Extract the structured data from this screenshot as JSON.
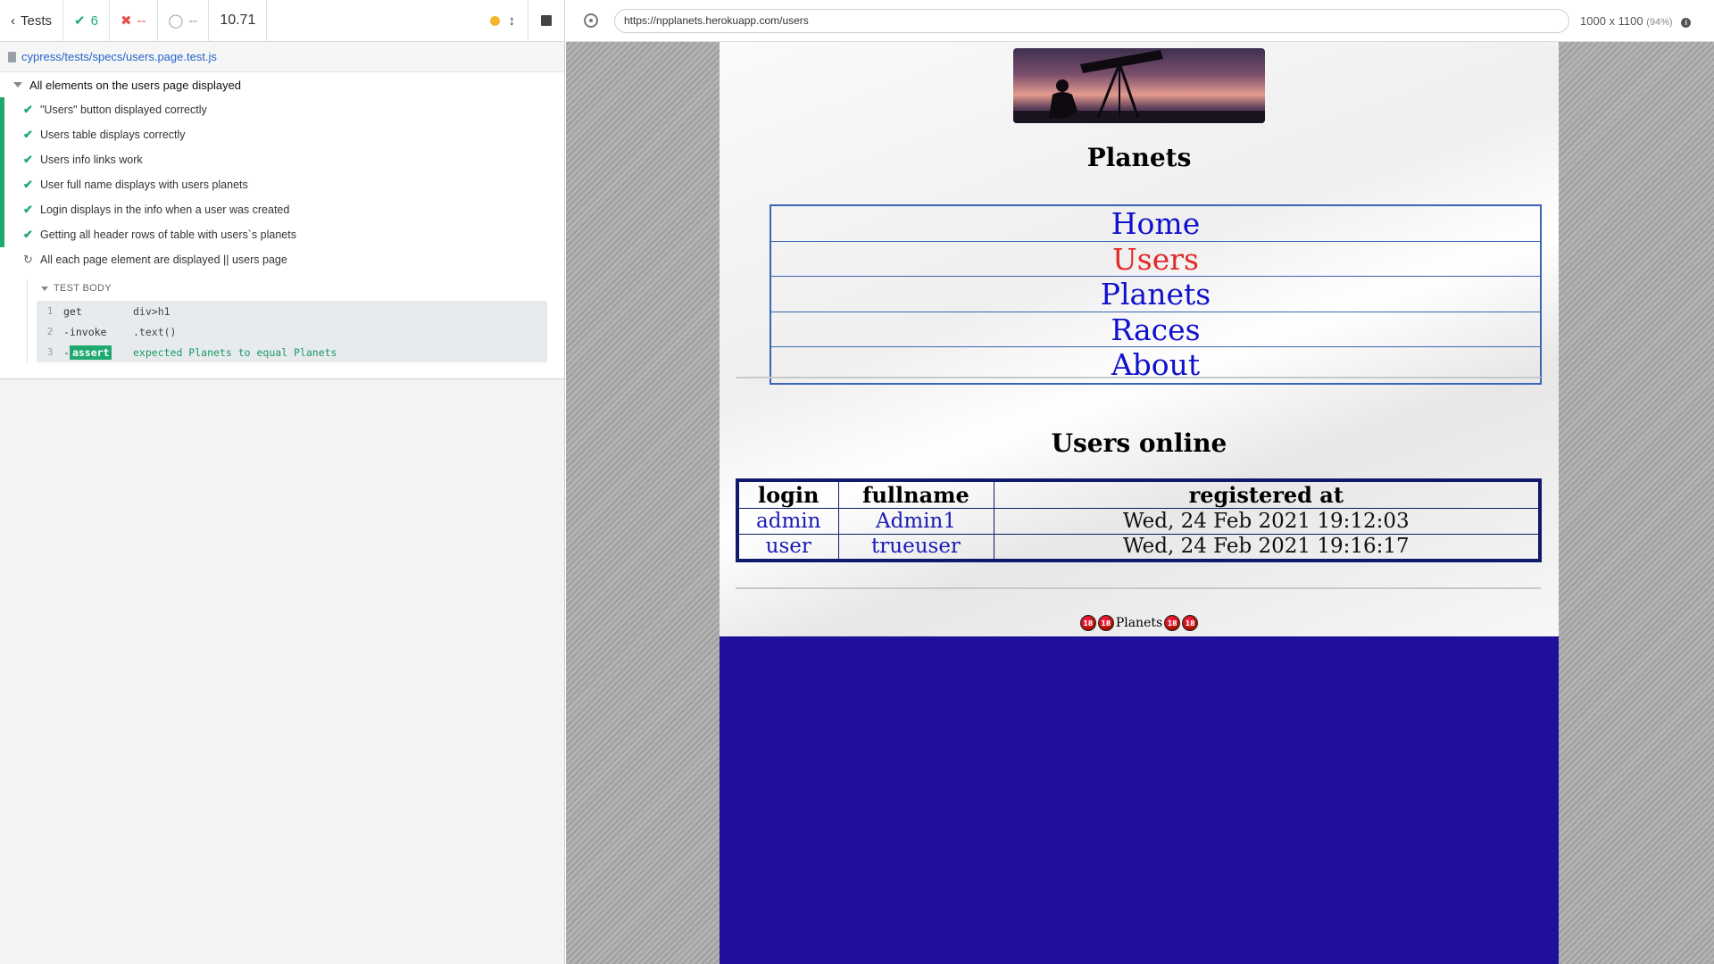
{
  "reporter": {
    "back_label": "Tests",
    "passed_count": "6",
    "failed_count": "--",
    "pending_count": "--",
    "duration": "10.71",
    "spec_path": "cypress/tests/specs/users.page.test.js",
    "suite_title": "All elements on the users page displayed",
    "tests": [
      "\"Users\" button displayed correctly",
      "Users table displays correctly",
      "Users info links work",
      "User full name displays with users planets",
      "Login displays in the info when a user was created",
      "Getting all header rows of table with users`s planets"
    ],
    "running_test": "All each page element are displayed || users page",
    "test_body_label": "TEST BODY",
    "commands": [
      {
        "num": "1",
        "name": "get",
        "msg": "div>h1"
      },
      {
        "num": "2",
        "name": "-invoke",
        "msg": ".text()"
      },
      {
        "num": "3",
        "name": "assert",
        "msg": "expected Planets to equal Planets"
      }
    ]
  },
  "aut": {
    "url": "https://npplanets.herokuapp.com/users",
    "viewport": "1000 x 1100",
    "zoom": "(94%)"
  },
  "site": {
    "title": "Planets",
    "nav": [
      "Home",
      "Users",
      "Planets",
      "Races",
      "About"
    ],
    "active_nav": "Users",
    "users_heading": "Users online",
    "table": {
      "headers": [
        "login",
        "fullname",
        "registered at"
      ],
      "rows": [
        [
          "admin",
          "Admin1",
          "Wed, 24 Feb 2021 19:12:03"
        ],
        [
          "user",
          "trueuser",
          "Wed, 24 Feb 2021 19:16:17"
        ]
      ]
    },
    "footer_text": "Planets",
    "footer_badge": "18"
  },
  "colors": {
    "pass": "#1fa971",
    "fail": "#e94f4f",
    "link": "#1010cc",
    "active_link": "#e22a2a",
    "frame_background": "#1f0f9a"
  }
}
